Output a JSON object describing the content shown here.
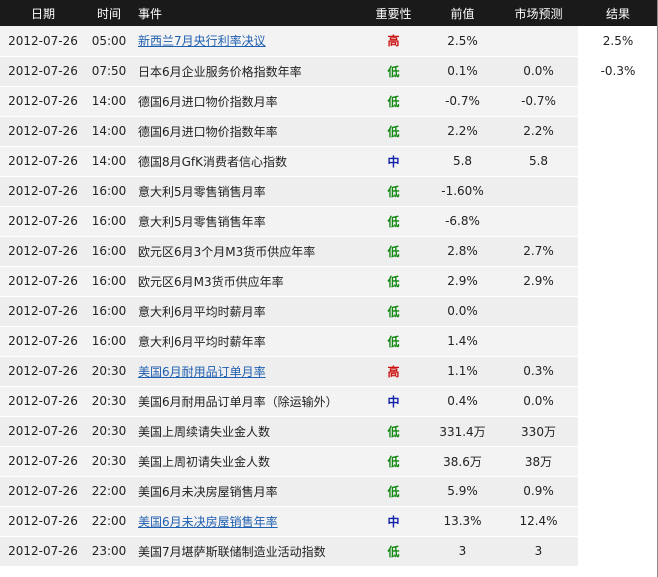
{
  "colors": {
    "header_bg": "#1a1a1a",
    "row_bg": "#eeeeee",
    "link": "#1f5fb0",
    "importance_high": "#cc1111",
    "importance_low": "#118811",
    "importance_medium": "#1122aa"
  },
  "headers": {
    "date": "日期",
    "time": "时间",
    "event": "事件",
    "importance": "重要性",
    "previous": "前值",
    "forecast": "市场预测",
    "actual": "结果"
  },
  "rows": [
    {
      "date": "2012-07-26",
      "time": "05:00",
      "event": "新西兰7月央行利率决议",
      "link": true,
      "importance": "高",
      "level": "high",
      "previous": "2.5%",
      "forecast": "",
      "actual": "2.5%"
    },
    {
      "date": "2012-07-26",
      "time": "07:50",
      "event": "日本6月企业服务价格指数年率",
      "link": false,
      "importance": "低",
      "level": "low",
      "previous": "0.1%",
      "forecast": "0.0%",
      "actual": "-0.3%"
    },
    {
      "date": "2012-07-26",
      "time": "14:00",
      "event": "德国6月进口物价指数月率",
      "link": false,
      "importance": "低",
      "level": "low",
      "previous": "-0.7%",
      "forecast": "-0.7%",
      "actual": ""
    },
    {
      "date": "2012-07-26",
      "time": "14:00",
      "event": "德国6月进口物价指数年率",
      "link": false,
      "importance": "低",
      "level": "low",
      "previous": "2.2%",
      "forecast": "2.2%",
      "actual": ""
    },
    {
      "date": "2012-07-26",
      "time": "14:00",
      "event": "德国8月GfK消费者信心指数",
      "link": false,
      "importance": "中",
      "level": "medium",
      "previous": "5.8",
      "forecast": "5.8",
      "actual": ""
    },
    {
      "date": "2012-07-26",
      "time": "16:00",
      "event": "意大利5月零售销售月率",
      "link": false,
      "importance": "低",
      "level": "low",
      "previous": "-1.60%",
      "forecast": "",
      "actual": ""
    },
    {
      "date": "2012-07-26",
      "time": "16:00",
      "event": "意大利5月零售销售年率",
      "link": false,
      "importance": "低",
      "level": "low",
      "previous": "-6.8%",
      "forecast": "",
      "actual": ""
    },
    {
      "date": "2012-07-26",
      "time": "16:00",
      "event": "欧元区6月3个月M3货币供应年率",
      "link": false,
      "importance": "低",
      "level": "low",
      "previous": "2.8%",
      "forecast": "2.7%",
      "actual": ""
    },
    {
      "date": "2012-07-26",
      "time": "16:00",
      "event": "欧元区6月M3货币供应年率",
      "link": false,
      "importance": "低",
      "level": "low",
      "previous": "2.9%",
      "forecast": "2.9%",
      "actual": ""
    },
    {
      "date": "2012-07-26",
      "time": "16:00",
      "event": "意大利6月平均时薪月率",
      "link": false,
      "importance": "低",
      "level": "low",
      "previous": "0.0%",
      "forecast": "",
      "actual": ""
    },
    {
      "date": "2012-07-26",
      "time": "16:00",
      "event": "意大利6月平均时薪年率",
      "link": false,
      "importance": "低",
      "level": "low",
      "previous": "1.4%",
      "forecast": "",
      "actual": ""
    },
    {
      "date": "2012-07-26",
      "time": "20:30",
      "event": "美国6月耐用品订单月率",
      "link": true,
      "importance": "高",
      "level": "high",
      "previous": "1.1%",
      "forecast": "0.3%",
      "actual": ""
    },
    {
      "date": "2012-07-26",
      "time": "20:30",
      "event": "美国6月耐用品订单月率（除运输外）",
      "link": false,
      "importance": "中",
      "level": "medium",
      "previous": "0.4%",
      "forecast": "0.0%",
      "actual": ""
    },
    {
      "date": "2012-07-26",
      "time": "20:30",
      "event": "美国上周续请失业金人数",
      "link": false,
      "importance": "低",
      "level": "low",
      "previous": "331.4万",
      "forecast": "330万",
      "actual": ""
    },
    {
      "date": "2012-07-26",
      "time": "20:30",
      "event": "美国上周初请失业金人数",
      "link": false,
      "importance": "低",
      "level": "low",
      "previous": "38.6万",
      "forecast": "38万",
      "actual": ""
    },
    {
      "date": "2012-07-26",
      "time": "22:00",
      "event": "美国6月未决房屋销售月率",
      "link": false,
      "importance": "低",
      "level": "low",
      "previous": "5.9%",
      "forecast": "0.9%",
      "actual": ""
    },
    {
      "date": "2012-07-26",
      "time": "22:00",
      "event": "美国6月未决房屋销售年率",
      "link": true,
      "importance": "中",
      "level": "medium",
      "previous": "13.3%",
      "forecast": "12.4%",
      "actual": ""
    },
    {
      "date": "2012-07-26",
      "time": "23:00",
      "event": "美国7月堪萨斯联储制造业活动指数",
      "link": false,
      "importance": "低",
      "level": "low",
      "previous": "3",
      "forecast": "3",
      "actual": ""
    }
  ]
}
